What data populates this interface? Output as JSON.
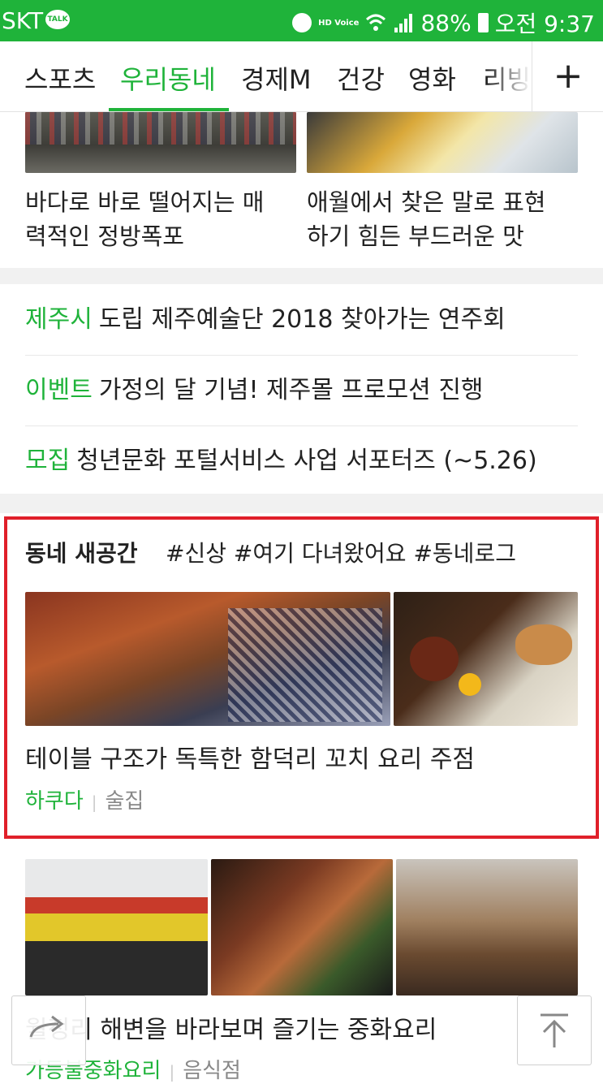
{
  "status_bar": {
    "carrier": "SKT",
    "talk_badge": "TALK",
    "hd_label": "HD Voice",
    "battery": "88%",
    "time": "오전 9:37",
    "icons": [
      "kakaotalk-icon",
      "alarm-icon",
      "hd-voice-icon",
      "wifi-icon",
      "signal-icon",
      "battery-icon"
    ]
  },
  "tabs": {
    "items": [
      "스포츠",
      "우리동네",
      "경제M",
      "건강",
      "영화",
      "리빙"
    ],
    "active": "우리동네",
    "add_label": "+"
  },
  "top_cards": [
    {
      "title_line1": "바다로 바로 떨어지는 매",
      "title_line2": "력적인 정방폭포"
    },
    {
      "title_line1": "애월에서 찾은 말로 표현",
      "title_line2": "하기 힘든 부드러운 맛"
    }
  ],
  "news_list": [
    {
      "tag": "제주시",
      "text": "도립 제주예술단 2018 찾아가는 연주회"
    },
    {
      "tag": "이벤트",
      "text": "가정의 달 기념! 제주몰 프로모션 진행"
    },
    {
      "tag": "모집",
      "text": "청년문화 포털서비스 사업 서포터즈 (~5.26)"
    }
  ],
  "new_space": {
    "heading": "동네 새공간",
    "hashtags": "#신상 #여기 다녀왔어요 #동네로그",
    "card_title": "테이블 구조가 독특한 함덕리 꼬치 요리 주점",
    "place": "하쿠다",
    "category": "술집"
  },
  "bottom_card": {
    "title": "월정리 해변을 바라보며 즐기는 중화요리",
    "place": "가등불중화요리",
    "category": "음식점"
  },
  "float_buttons": {
    "share_icon": "share-arrow-icon",
    "top_icon": "scroll-top-icon"
  },
  "colors": {
    "brand_green": "#1fb33a",
    "highlight_red": "#e0202a"
  }
}
